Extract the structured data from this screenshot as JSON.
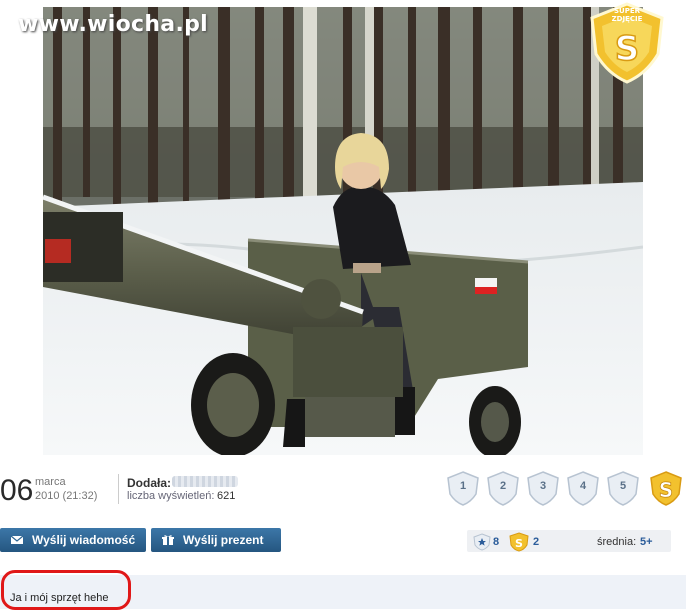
{
  "site": {
    "watermark": "www.wiocha.pl"
  },
  "badge": {
    "top_text": "SUPER ZDJĘCIE",
    "letter": "S"
  },
  "photo": {
    "alt": "Girl sitting on an artillery cannon in a snowy forest"
  },
  "post": {
    "day": "06",
    "month": "marca",
    "datetime": "2010 (21:32)",
    "author_label": "Dodała:",
    "views_label": "liczba wyświetleń:",
    "views": "621"
  },
  "ratings": [
    "1",
    "2",
    "3",
    "4",
    "5"
  ],
  "buttons": {
    "message": "Wyślij wiadomość",
    "gift": "Wyślij prezent"
  },
  "stats": {
    "stars": "8",
    "super": "2",
    "avg_label": "średnia:",
    "avg_value": "5+"
  },
  "caption": "Ja i mój sprzęt hehe",
  "colors": {
    "accent_blue": "#2b5c9a",
    "button_blue": "#2f6693",
    "highlight_red": "#e01818",
    "gold": "#f2c12e"
  }
}
